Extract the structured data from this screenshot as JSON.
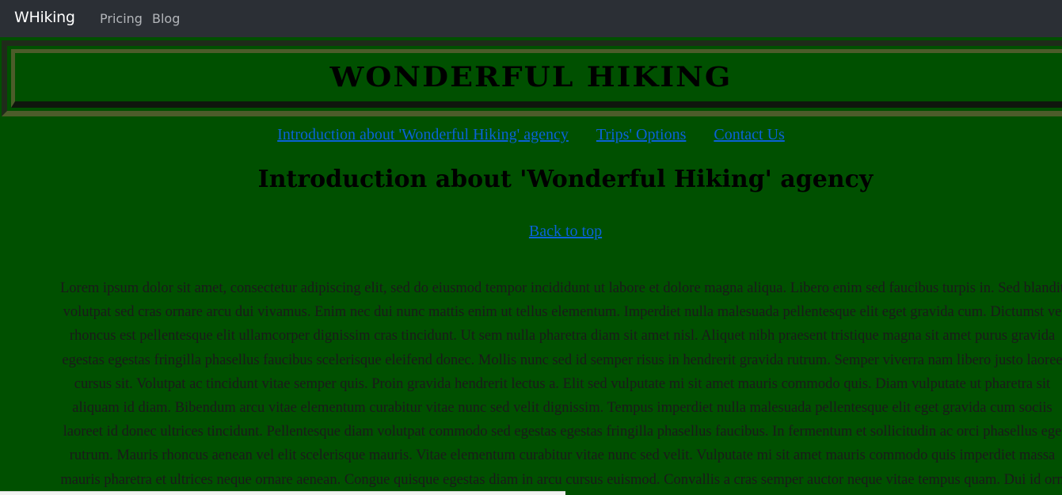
{
  "topnav": {
    "brand": "WHiking",
    "links": [
      "Pricing",
      "Blog"
    ]
  },
  "banner": {
    "title": "WONDERFUL HIKING"
  },
  "section_nav": [
    "Introduction about 'Wonderful Hiking' agency",
    "Trips' Options",
    "Contact Us"
  ],
  "intro": {
    "heading": "Introduction about 'Wonderful Hiking' agency",
    "back_to_top": "Back to top",
    "lines": [
      "Lorem ipsum dolor sit amet, consectetur adipiscing elit, sed do eiusmod tempor incididunt ut labore et dolore magna aliqua. Libero enim sed faucibus turpis in. Sed blandit",
      "volutpat sed cras ornare arcu dui vivamus. Enim nec dui nunc mattis enim ut tellus elementum. Imperdiet nulla malesuada pellentesque elit eget gravida cum. Dictumst ve",
      "rhoncus est pellentesque elit ullamcorper dignissim cras tincidunt. Ut sem nulla pharetra diam sit amet nisl. Aliquet nibh praesent tristique magna sit amet purus gravida",
      "egestas egestas fringilla phasellus faucibus scelerisque eleifend donec. Mollis nunc sed id semper risus in hendrerit gravida rutrum. Semper viverra nam libero justo laoree",
      "cursus sit. Volutpat ac tincidunt vitae semper quis. Proin gravida hendrerit lectus a. Elit sed vulputate mi sit amet mauris commodo quis. Diam vulputate ut pharetra sit",
      "aliquam id diam. Bibendum arcu vitae elementum curabitur vitae nunc sed velit dignissim. Tempus imperdiet nulla malesuada pellentesque elit eget gravida cum sociis",
      "laoreet id donec ultrices tincidunt. Pellentesque diam volutpat commodo sed egestas egestas fringilla phasellus faucibus. In fermentum et sollicitudin ac orci phasellus ege",
      "rutrum. Mauris rhoncus aenean vel elit scelerisque mauris. Vitae elementum curabitur vitae nunc sed velit. Vulputate mi sit amet mauris commodo quis imperdiet massa",
      "mauris pharetra et ultrices neque ornare aenean. Congue quisque egestas diam in arcu cursus euismod. Convallis a cras semper auctor neque vitae tempus quam. Dui id orn"
    ]
  },
  "colors": {
    "page_background": "#005000",
    "topnav_background": "#2b2f35",
    "link": "#0a62d8",
    "banner_border_dark": "#1f2b1a",
    "banner_border_light": "#4c5c2a"
  }
}
